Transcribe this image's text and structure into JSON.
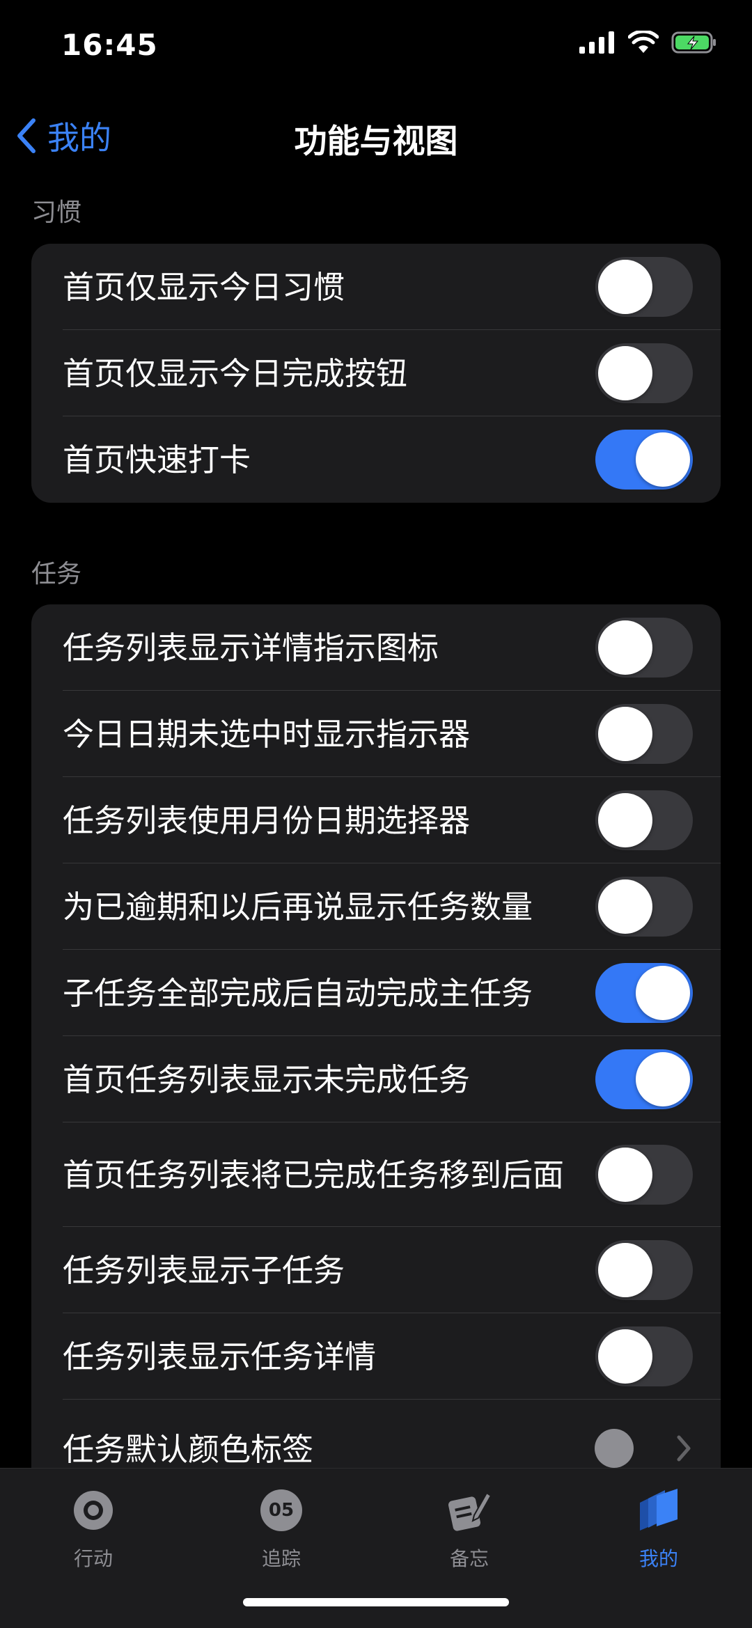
{
  "status": {
    "time": "16:45"
  },
  "nav": {
    "back_label": "我的",
    "title": "功能与视图"
  },
  "habits": {
    "header": "习惯",
    "items": [
      {
        "label": "首页仅显示今日习惯",
        "on": false
      },
      {
        "label": "首页仅显示今日完成按钮",
        "on": false
      },
      {
        "label": "首页快速打卡",
        "on": true
      }
    ]
  },
  "tasks": {
    "header": "任务",
    "items": [
      {
        "label": "任务列表显示详情指示图标",
        "on": false
      },
      {
        "label": "今日日期未选中时显示指示器",
        "on": false
      },
      {
        "label": "任务列表使用月份日期选择器",
        "on": false
      },
      {
        "label": "为已逾期和以后再说显示任务数量",
        "on": false
      },
      {
        "label": "子任务全部完成后自动完成主任务",
        "on": true
      },
      {
        "label": "首页任务列表显示未完成任务",
        "on": true
      },
      {
        "label": "首页任务列表将已完成任务移到后面",
        "on": false
      },
      {
        "label": "任务列表显示子任务",
        "on": false
      },
      {
        "label": "任务列表显示任务详情",
        "on": false
      },
      {
        "label": "任务默认颜色标签",
        "color": "#8e8e93"
      }
    ]
  },
  "tabbar": {
    "tabs": [
      {
        "label": "行动",
        "icon": "target-icon",
        "active": false
      },
      {
        "label": "追踪",
        "icon": "calendar-badge-icon",
        "badge": "05",
        "active": false
      },
      {
        "label": "备忘",
        "icon": "memo-pen-icon",
        "active": false
      },
      {
        "label": "我的",
        "icon": "stack-cards-icon",
        "active": true
      }
    ]
  },
  "colors": {
    "accent": "#3478f6",
    "background": "#000000",
    "card": "#1c1c1e"
  }
}
